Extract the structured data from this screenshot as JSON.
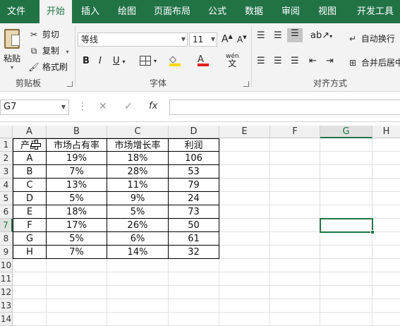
{
  "ribbon_tabs": [
    {
      "label": "文件",
      "active": false
    },
    {
      "label": "开始",
      "active": true
    },
    {
      "label": "插入",
      "active": false
    },
    {
      "label": "绘图",
      "active": false
    },
    {
      "label": "页面布局",
      "active": false
    },
    {
      "label": "公式",
      "active": false
    },
    {
      "label": "数据",
      "active": false
    },
    {
      "label": "审阅",
      "active": false
    },
    {
      "label": "视图",
      "active": false
    },
    {
      "label": "开发工具",
      "active": false
    }
  ],
  "clipboard": {
    "paste": "粘贴",
    "cut": "剪切",
    "copy": "复制",
    "format_painter": "格式刷",
    "group_label": "剪贴板"
  },
  "font": {
    "name": "等线",
    "size": "11",
    "bold": "B",
    "italic": "I",
    "underline": "U",
    "increase": "A",
    "decrease": "A",
    "color_letter": "A",
    "phonetic": "wén",
    "group_label": "字体"
  },
  "alignment": {
    "wrap_text": "自动换行",
    "merge_center": "合并后居中",
    "group_label": "对齐方式"
  },
  "formula_bar": {
    "name_box": "G7",
    "cancel": "✕",
    "enter": "✓",
    "fx": "fx",
    "value": ""
  },
  "colors": {
    "accent": "#217346",
    "fill_yellow": "#ffd700",
    "font_red": "#e02020"
  },
  "columns": [
    "A",
    "B",
    "C",
    "D",
    "E",
    "F",
    "G",
    "H"
  ],
  "rows": [
    "1",
    "2",
    "3",
    "4",
    "5",
    "6",
    "7",
    "8",
    "9",
    "10",
    "11",
    "12",
    "13",
    "14"
  ],
  "selected_cell": "G7",
  "table": {
    "headers": [
      "产品",
      "市场占有率",
      "市场增长率",
      "利润"
    ],
    "rows": [
      [
        "A",
        "19%",
        "18%",
        "106"
      ],
      [
        "B",
        "7%",
        "28%",
        "53"
      ],
      [
        "C",
        "13%",
        "11%",
        "79"
      ],
      [
        "D",
        "5%",
        "9%",
        "24"
      ],
      [
        "E",
        "18%",
        "5%",
        "73"
      ],
      [
        "F",
        "17%",
        "26%",
        "50"
      ],
      [
        "G",
        "5%",
        "6%",
        "61"
      ],
      [
        "H",
        "7%",
        "14%",
        "32"
      ]
    ]
  }
}
